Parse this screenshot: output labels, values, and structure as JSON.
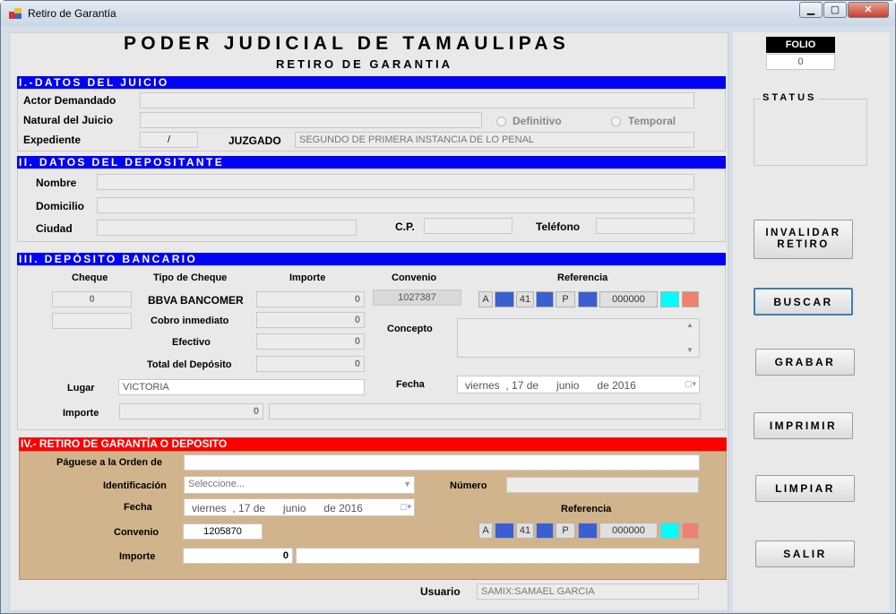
{
  "window": {
    "title": "Retiro de Garantía"
  },
  "header": {
    "title": "PODER JUDICIAL DE TAMAULIPAS",
    "subtitle": "RETIRO DE GARANTIA"
  },
  "folio": {
    "label": "FOLIO",
    "value": "0"
  },
  "status": {
    "label": "STATUS"
  },
  "sec1": {
    "title": "I.-DATOS DEL JUICIO",
    "actor_label": "Actor Demandado",
    "natural_label": "Natural del Juicio",
    "definitivo": "Definitivo",
    "temporal": "Temporal",
    "expediente_label": "Expediente",
    "expediente_value": "/",
    "juzgado_label": "JUZGADO",
    "juzgado_value": "SEGUNDO DE PRIMERA INSTANCIA DE LO PENAL"
  },
  "sec2": {
    "title": "II. DATOS DEL DEPOSITANTE",
    "nombre": "Nombre",
    "domicilio": "Domicilio",
    "ciudad": "Ciudad",
    "cp": "C.P.",
    "telefono": "Teléfono"
  },
  "sec3": {
    "title": "III. DEPÓSITO BANCARIO",
    "h_cheque": "Cheque",
    "h_tipo": "Tipo de Cheque",
    "h_importe": "Importe",
    "h_convenio": "Convenio",
    "h_referencia": "Referencia",
    "cheque_value": "0",
    "banco": "BBVA BANCOMER",
    "banco_importe": "0",
    "convenio_value": "1027387",
    "cobro_label": "Cobro inmediato",
    "cobro_value": "0",
    "efectivo_label": "Efectivo",
    "efectivo_value": "0",
    "total_label": "Total del Depósito",
    "total_value": "0",
    "concepto_label": "Concepto",
    "lugar_label": "Lugar",
    "lugar_value": "VICTORIA",
    "fecha_label": "Fecha",
    "fecha_value": "viernes  , 17 de      junio      de 2016",
    "importe_label": "Importe",
    "importe_value": "0",
    "ref": {
      "a": "A",
      "n41": "41",
      "p": "P",
      "num": "000000"
    }
  },
  "sec4": {
    "title": "IV.- RETIRO DE GARANTÍA O DEPOSITO",
    "paguese_label": "Páguese a la Orden de",
    "ident_label": "Identificación",
    "ident_placeholder": "Seleccione...",
    "numero_label": "Número",
    "fecha_label": "Fecha",
    "fecha_value": "viernes  , 17 de      junio      de 2016",
    "referencia_label": "Referencia",
    "convenio_label": "Convenio",
    "convenio_value": "1205870",
    "importe_label": "Importe",
    "importe_value": "0",
    "ref": {
      "a": "A",
      "n41": "41",
      "p": "P",
      "num": "000000"
    }
  },
  "usuario": {
    "label": "Usuario",
    "value": "SAMIX:SAMAEL GARCIA"
  },
  "buttons": {
    "invalidar_1": "INVALIDAR",
    "invalidar_2": "RETIRO",
    "buscar": "BUSCAR",
    "grabar": "GRABAR",
    "imprimir": "IMPRIMIR",
    "limpiar": "LIMPIAR",
    "salir": "SALIR"
  },
  "colors": {
    "section_blue": "#0202f4",
    "section_red": "#ff0000",
    "ref_blue": "#3a5fd0",
    "ref_cyan": "#00ffff",
    "ref_salmon": "#f08070",
    "retiro_bg": "#d2b48c"
  }
}
